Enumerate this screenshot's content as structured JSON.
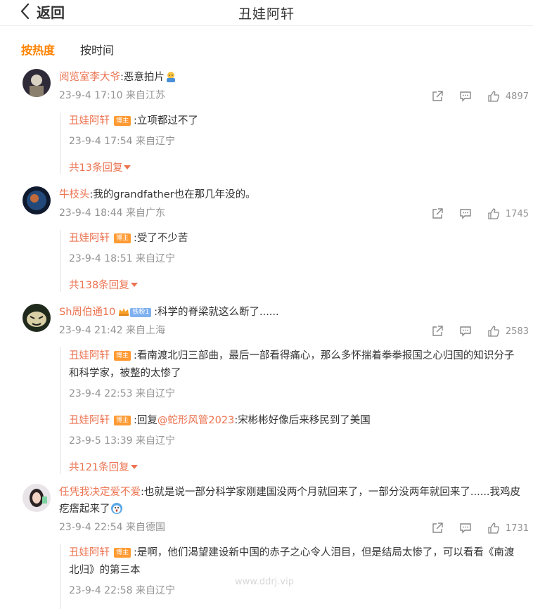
{
  "header": {
    "back_label": "返回",
    "title": "丑娃阿轩"
  },
  "sort_tabs": [
    "按热度",
    "按时间"
  ],
  "badge_label": "博主",
  "comments": [
    {
      "user": "阅览室李大爷",
      "text": ":恶意拍片",
      "meta": "23-9-4 17:10 来自江苏",
      "likes": "4897",
      "replies": [
        {
          "user": "丑娃阿轩",
          "text": ":立项都过不了",
          "meta": "23-9-4 17:54 来自辽宁"
        }
      ],
      "more": "共13条回复"
    },
    {
      "user": "牛枝头",
      "text": ":我的grandfather也在那几年没的。",
      "meta": "23-9-4 18:44 来自广东",
      "likes": "1745",
      "replies": [
        {
          "user": "丑娃阿轩",
          "text": ":受了不少苦",
          "meta": "23-9-4 18:51 来自辽宁"
        }
      ],
      "more": "共138条回复"
    },
    {
      "user": "Sh周伯通10",
      "fan_badge": "铁粉1",
      "text": ":科学的脊梁就这么断了......",
      "meta": "23-9-4 21:42 来自上海",
      "likes": "2583",
      "replies": [
        {
          "user": "丑娃阿轩",
          "text": ":看南渡北归三部曲，最后一部看得痛心，那么多怀揣着拳拳报国之心归国的知识分子和科学家，被整的太惨了",
          "meta": "23-9-4 22:53 来自辽宁"
        },
        {
          "user": "丑娃阿轩",
          "text_prefix": ":回复",
          "mention": "@蛇形风管2023",
          "text": ":宋彬彬好像后来移民到了美国",
          "meta": "23-9-5 13:39 来自辽宁"
        }
      ],
      "more": "共121条回复"
    },
    {
      "user": "任凭我决定爱不爱",
      "text": ":也就是说一部分科学家刚建国没两个月就回来了，一部分没两年就回来了......我鸡皮疙瘩起来了",
      "meta": "23-9-4 22:54 来自德国",
      "likes": "1731",
      "replies": [
        {
          "user": "丑娃阿轩",
          "text": ":是啊，他们渴望建设新中国的赤子之心令人泪目，但是结局太惨了，可以看看《南渡北归》的第三本",
          "meta": "23-9-4 22:58 来自辽宁"
        }
      ]
    }
  ],
  "watermark": "www.ddrj.vip"
}
